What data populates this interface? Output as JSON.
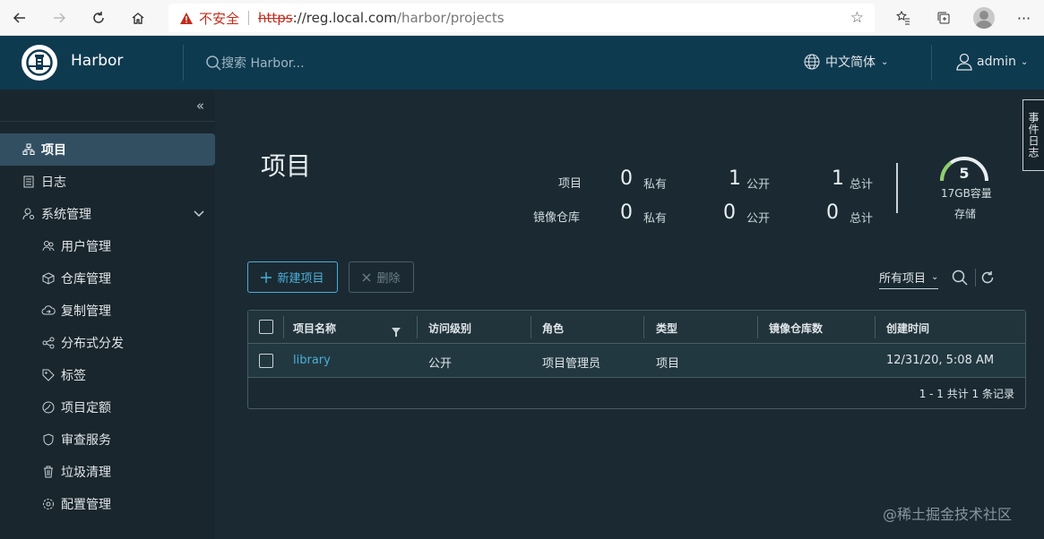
{
  "browser": {
    "insecure_label": "不安全",
    "url_scheme": "https",
    "url_host": "://reg.local.com",
    "url_path": "/harbor/projects"
  },
  "header": {
    "app_name": "Harbor",
    "search_placeholder": "搜索 Harbor...",
    "language": "中文简体",
    "user": "admin"
  },
  "sidebar": {
    "items": [
      {
        "label": "项目",
        "icon": "projects-icon",
        "active": true
      },
      {
        "label": "日志",
        "icon": "logs-icon"
      },
      {
        "label": "系统管理",
        "icon": "admin-icon",
        "expanded": true
      },
      {
        "label": "用户管理",
        "icon": "users-icon",
        "sub": true
      },
      {
        "label": "仓库管理",
        "icon": "registry-icon",
        "sub": true
      },
      {
        "label": "复制管理",
        "icon": "replication-icon",
        "sub": true
      },
      {
        "label": "分布式分发",
        "icon": "distribution-icon",
        "sub": true
      },
      {
        "label": "标签",
        "icon": "tag-icon",
        "sub": true
      },
      {
        "label": "项目定额",
        "icon": "quota-icon",
        "sub": true
      },
      {
        "label": "审查服务",
        "icon": "shield-icon",
        "sub": true
      },
      {
        "label": "垃圾清理",
        "icon": "trash-icon",
        "sub": true
      },
      {
        "label": "配置管理",
        "icon": "gear-icon",
        "sub": true
      }
    ]
  },
  "main": {
    "title": "项目",
    "stats": {
      "projects_label": "项目",
      "repos_label": "镜像仓库",
      "private_label": "私有",
      "public_label": "公开",
      "total_label": "总计",
      "projects_private": "0",
      "projects_public": "1",
      "projects_total": "1",
      "repos_private": "0",
      "repos_public": "0",
      "repos_total": "0"
    },
    "storage": {
      "value": "5",
      "capacity": "17GB容量",
      "label": "存储",
      "fill_fraction": 0.3
    },
    "actions": {
      "new_project": "新建项目",
      "delete": "删除",
      "filter": "所有项目"
    },
    "table": {
      "headers": [
        "项目名称",
        "访问级别",
        "角色",
        "类型",
        "镜像仓库数",
        "创建时间"
      ],
      "rows": [
        {
          "name": "library",
          "access": "公开",
          "role": "项目管理员",
          "type": "项目",
          "repo_count": "",
          "created": "12/31/20, 5:08 AM"
        }
      ],
      "footer": "1 - 1 共计 1 条记录"
    },
    "event_log_tab": "事件日志"
  },
  "watermark": "@稀土掘金技术社区",
  "colors": {
    "header_bg": "#0e3a4f",
    "accent": "#49afd9",
    "sidebar_bg": "#1a262d",
    "main_bg": "#1b2a32"
  }
}
